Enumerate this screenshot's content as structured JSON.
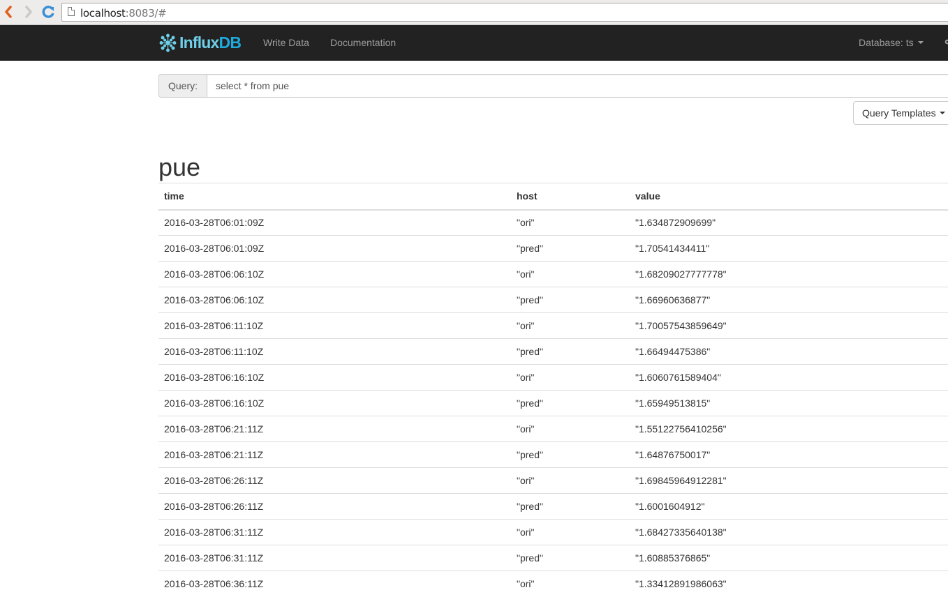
{
  "browser": {
    "url_host": "localhost",
    "url_rest": ":8083/#"
  },
  "navbar": {
    "brand_part1": "Influx",
    "brand_part2": "DB",
    "links": [
      {
        "label": "Write Data"
      },
      {
        "label": "Documentation"
      }
    ],
    "database_label": "Database: ts"
  },
  "query": {
    "addon_label": "Query:",
    "value": "select * from pue",
    "templates_label": "Query Templates"
  },
  "result": {
    "series_name": "pue",
    "columns": [
      "time",
      "host",
      "value"
    ],
    "rows": [
      [
        "2016-03-28T06:01:09Z",
        "\"ori\"",
        "\"1.634872909699\""
      ],
      [
        "2016-03-28T06:01:09Z",
        "\"pred\"",
        "\"1.70541434411\""
      ],
      [
        "2016-03-28T06:06:10Z",
        "\"ori\"",
        "\"1.68209027777778\""
      ],
      [
        "2016-03-28T06:06:10Z",
        "\"pred\"",
        "\"1.66960636877\""
      ],
      [
        "2016-03-28T06:11:10Z",
        "\"ori\"",
        "\"1.70057543859649\""
      ],
      [
        "2016-03-28T06:11:10Z",
        "\"pred\"",
        "\"1.66494475386\""
      ],
      [
        "2016-03-28T06:16:10Z",
        "\"ori\"",
        "\"1.6060761589404\""
      ],
      [
        "2016-03-28T06:16:10Z",
        "\"pred\"",
        "\"1.65949513815\""
      ],
      [
        "2016-03-28T06:21:11Z",
        "\"ori\"",
        "\"1.55122756410256\""
      ],
      [
        "2016-03-28T06:21:11Z",
        "\"pred\"",
        "\"1.64876750017\""
      ],
      [
        "2016-03-28T06:26:11Z",
        "\"ori\"",
        "\"1.69845964912281\""
      ],
      [
        "2016-03-28T06:26:11Z",
        "\"pred\"",
        "\"1.6001604912\""
      ],
      [
        "2016-03-28T06:31:11Z",
        "\"ori\"",
        "\"1.68427335640138\""
      ],
      [
        "2016-03-28T06:31:11Z",
        "\"pred\"",
        "\"1.60885376865\""
      ],
      [
        "2016-03-28T06:36:11Z",
        "\"ori\"",
        "\"1.33412891986063\""
      ]
    ]
  }
}
